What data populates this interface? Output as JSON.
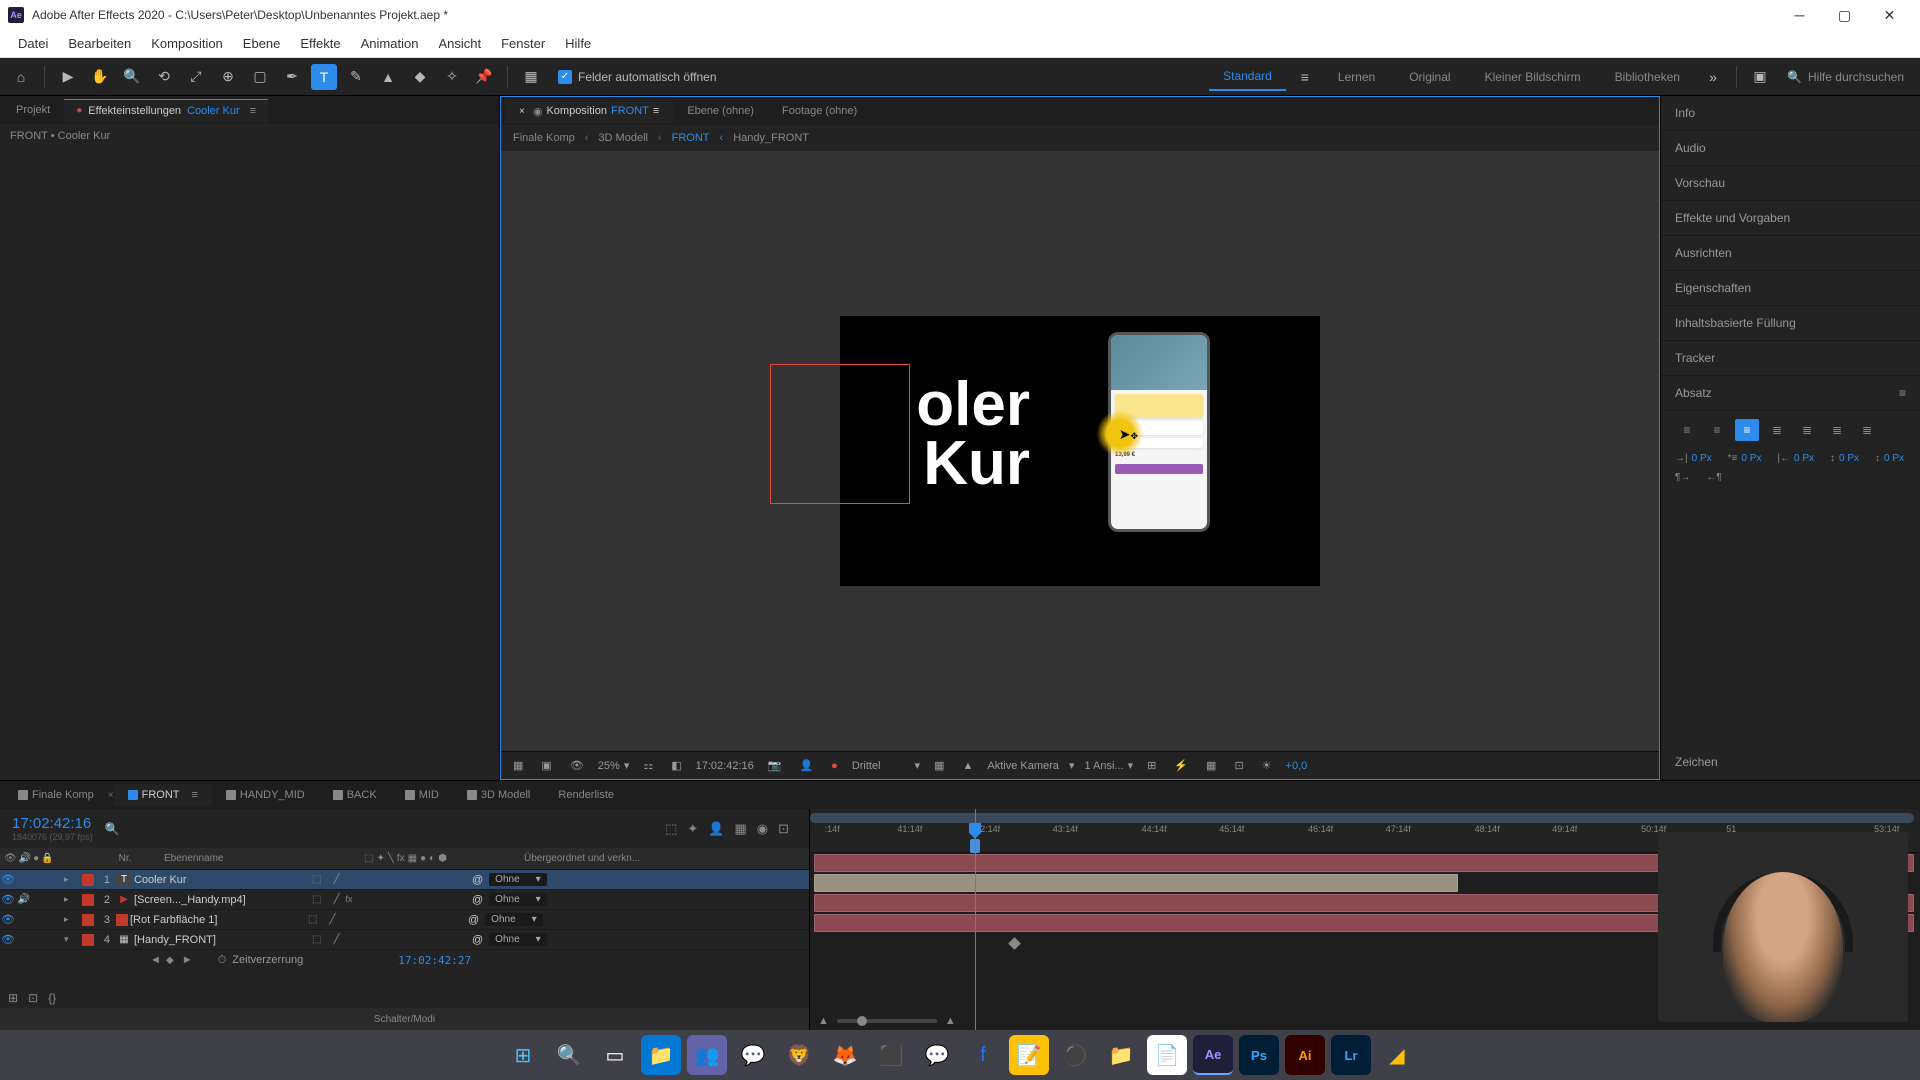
{
  "titlebar": {
    "app_icon": "Ae",
    "title": "Adobe After Effects 2020 - C:\\Users\\Peter\\Desktop\\Unbenanntes Projekt.aep *"
  },
  "menubar": {
    "items": [
      "Datei",
      "Bearbeiten",
      "Komposition",
      "Ebene",
      "Effekte",
      "Animation",
      "Ansicht",
      "Fenster",
      "Hilfe"
    ]
  },
  "toolbar": {
    "auto_open_label": "Felder automatisch öffnen",
    "workspaces": [
      "Standard",
      "Lernen",
      "Original",
      "Kleiner Bildschirm",
      "Bibliotheken"
    ],
    "active_workspace": "Standard",
    "search_placeholder": "Hilfe durchsuchen"
  },
  "left_panel": {
    "tabs": {
      "project": "Projekt",
      "effect_controls": "Effekteinstellungen",
      "effect_target": "Cooler Kur"
    },
    "breadcrumb": "FRONT • Cooler Kur"
  },
  "center_panel": {
    "tabs": {
      "composition": "Komposition",
      "composition_name": "FRONT",
      "layer": "Ebene  (ohne)",
      "footage": "Footage  (ohne)"
    },
    "breadcrumb": [
      "Finale Komp",
      "3D Modell",
      "FRONT",
      "Handy_FRONT"
    ],
    "active_breadcrumb": "FRONT",
    "canvas_text_line1": "oler",
    "canvas_text_line2": "Kur",
    "footer": {
      "zoom": "25%",
      "timecode": "17:02:42:16",
      "resolution": "Drittel",
      "camera": "Aktive Kamera",
      "views": "1 Ansi...",
      "exposure": "+0,0"
    }
  },
  "right_panel": {
    "items": [
      "Info",
      "Audio",
      "Vorschau",
      "Effekte und Vorgaben",
      "Ausrichten",
      "Eigenschaften",
      "Inhaltsbasierte Füllung",
      "Tracker"
    ],
    "paragraph_label": "Absatz",
    "px_value": "0 Px",
    "zeichen_label": "Zeichen"
  },
  "timeline": {
    "tabs": [
      "Finale Komp",
      "FRONT",
      "HANDY_MID",
      "BACK",
      "MID",
      "3D Modell",
      "Renderliste"
    ],
    "active_tab": "FRONT",
    "timecode": "17:02:42:16",
    "framerate_hint": "1840076 (29,97 fps)",
    "header": {
      "index": "Nr.",
      "name": "Ebenenname",
      "parent": "Übergeordnet und verkn..."
    },
    "layers": [
      {
        "idx": "1",
        "type": "T",
        "name": "Cooler Kur",
        "parent": "Ohne",
        "color": "#c0392b",
        "selected": true,
        "eye": true
      },
      {
        "idx": "2",
        "type": "▶",
        "name": "[Screen..._Handy.mp4]",
        "parent": "Ohne",
        "color": "#c0392b",
        "eye": true,
        "audio": true,
        "fx": true
      },
      {
        "idx": "3",
        "type": "",
        "name": "[Rot Farbfläche 1]",
        "parent": "Ohne",
        "color": "#c0392b",
        "eye": true
      },
      {
        "idx": "4",
        "type": "▦",
        "name": "[Handy_FRONT]",
        "parent": "Ohne",
        "color": "#c0392b",
        "eye": true
      }
    ],
    "sub_property": {
      "name": "Zeitverzerrung",
      "value": "17:02:42:27"
    },
    "footer_label": "Schalter/Modi",
    "ruler_ticks": [
      ":14f",
      "41:14f",
      "42:14f",
      "43:14f",
      "44:14f",
      "45:14f",
      "46:14f",
      "47:14f",
      "48:14f",
      "49:14f",
      "50:14f",
      "51",
      "53:14f"
    ]
  },
  "taskbar": {
    "icons": [
      "windows",
      "search",
      "tasks",
      "explorer",
      "teams",
      "whatsapp",
      "brave",
      "firefox",
      "app1",
      "messenger",
      "facebook",
      "notes",
      "obs",
      "folder",
      "notepad",
      "ae",
      "ps",
      "ai",
      "lr",
      "app2"
    ]
  }
}
